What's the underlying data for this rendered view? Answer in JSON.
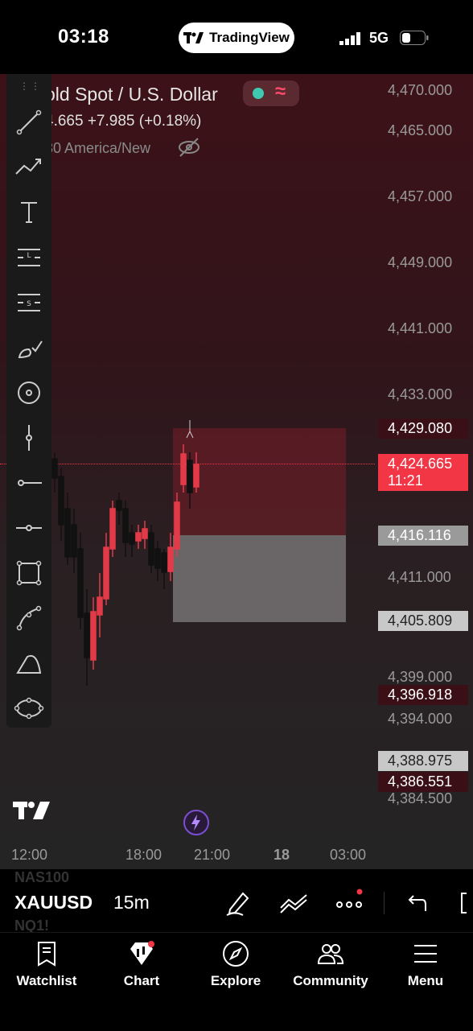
{
  "status_bar": {
    "time": "03:18",
    "app_pill": "TradingView",
    "network": "5G"
  },
  "chart": {
    "symbol_title": "old Spot / U.S. Dollar",
    "quote_line": "4.665  +7.985 (+0.18%)",
    "timezone_line": "30 America/New",
    "price_labels": [
      "4,470.000",
      "4,465.000",
      "4,457.000",
      "4,449.000",
      "4,441.000",
      "4,433.000",
      "4,411.000",
      "4,399.000",
      "4,394.000",
      "4,384.500"
    ],
    "price_tags": {
      "stop": "4,429.080",
      "current_price": "4,424.665",
      "countdown": "11:21",
      "entry": "4,416.116",
      "target": "4,405.809",
      "low_a": "4,396.918",
      "low_b": "4,388.975",
      "low_c": "4,386.551"
    },
    "time_labels": [
      "12:00",
      "18:00",
      "21:00",
      "18",
      "03:00"
    ]
  },
  "bottom_toolbar": {
    "symbol": "XAUUSD",
    "interval": "15m",
    "ghost_top": "NAS100",
    "ghost_bottom": "NQ1!"
  },
  "tabs": [
    "Watchlist",
    "Chart",
    "Explore",
    "Community",
    "Menu"
  ],
  "colors": {
    "accent_red": "#f23645",
    "zone_red": "#7a1e28",
    "zone_grey": "#969696"
  }
}
